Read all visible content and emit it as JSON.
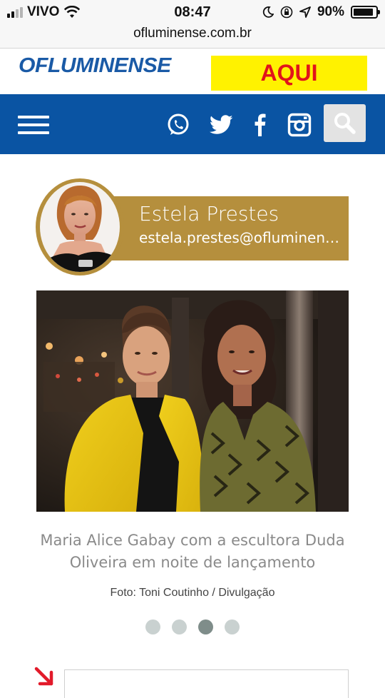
{
  "status_bar": {
    "carrier": "VIVO",
    "time": "08:47",
    "battery_percent": "90%",
    "battery_level": 0.9
  },
  "browser": {
    "url": "ofluminense.com.br"
  },
  "header": {
    "logo_text": "OFLUMINENSE",
    "ad_text": "AQUI",
    "colors": {
      "brand": "#1a5aa6",
      "nav": "#0a54a3",
      "ad_bg": "#fff200",
      "ad_text": "#e1141b"
    }
  },
  "nav": {
    "icons": [
      "menu-icon",
      "whatsapp-icon",
      "twitter-icon",
      "facebook-icon",
      "instagram-icon",
      "search-icon"
    ]
  },
  "author": {
    "name": "Estela Prestes",
    "email": "estela.prestes@ofluminense.com.br",
    "accent": "#b58f3d"
  },
  "article": {
    "caption": "Maria Alice Gabay com a escultora Duda Oliveira em noite de lançamento",
    "credit": "Foto: Toni Coutinho / Divulgação",
    "carousel_total": 4,
    "carousel_active": 3
  }
}
